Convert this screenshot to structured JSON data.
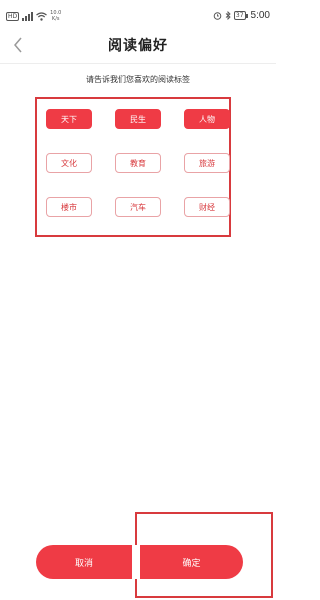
{
  "status_bar": {
    "hd_label": "HD",
    "net_speed_value": "10.0",
    "net_speed_unit": "K/s",
    "battery": "37",
    "time": "5:00"
  },
  "header": {
    "title": "阅读偏好"
  },
  "prompt": "请告诉我们您喜欢的阅读标签",
  "tags": [
    {
      "label": "天下",
      "selected": true
    },
    {
      "label": "民生",
      "selected": true
    },
    {
      "label": "人物",
      "selected": true
    },
    {
      "label": "文化",
      "selected": false
    },
    {
      "label": "教育",
      "selected": false
    },
    {
      "label": "旅游",
      "selected": false
    },
    {
      "label": "楼市",
      "selected": false
    },
    {
      "label": "汽车",
      "selected": false
    },
    {
      "label": "财经",
      "selected": false
    }
  ],
  "footer": {
    "cancel_label": "取消",
    "confirm_label": "确定"
  },
  "colors": {
    "accent": "#ef3b45",
    "highlight_box": "#d83a3e",
    "tag_border": "#e9a3a6"
  }
}
